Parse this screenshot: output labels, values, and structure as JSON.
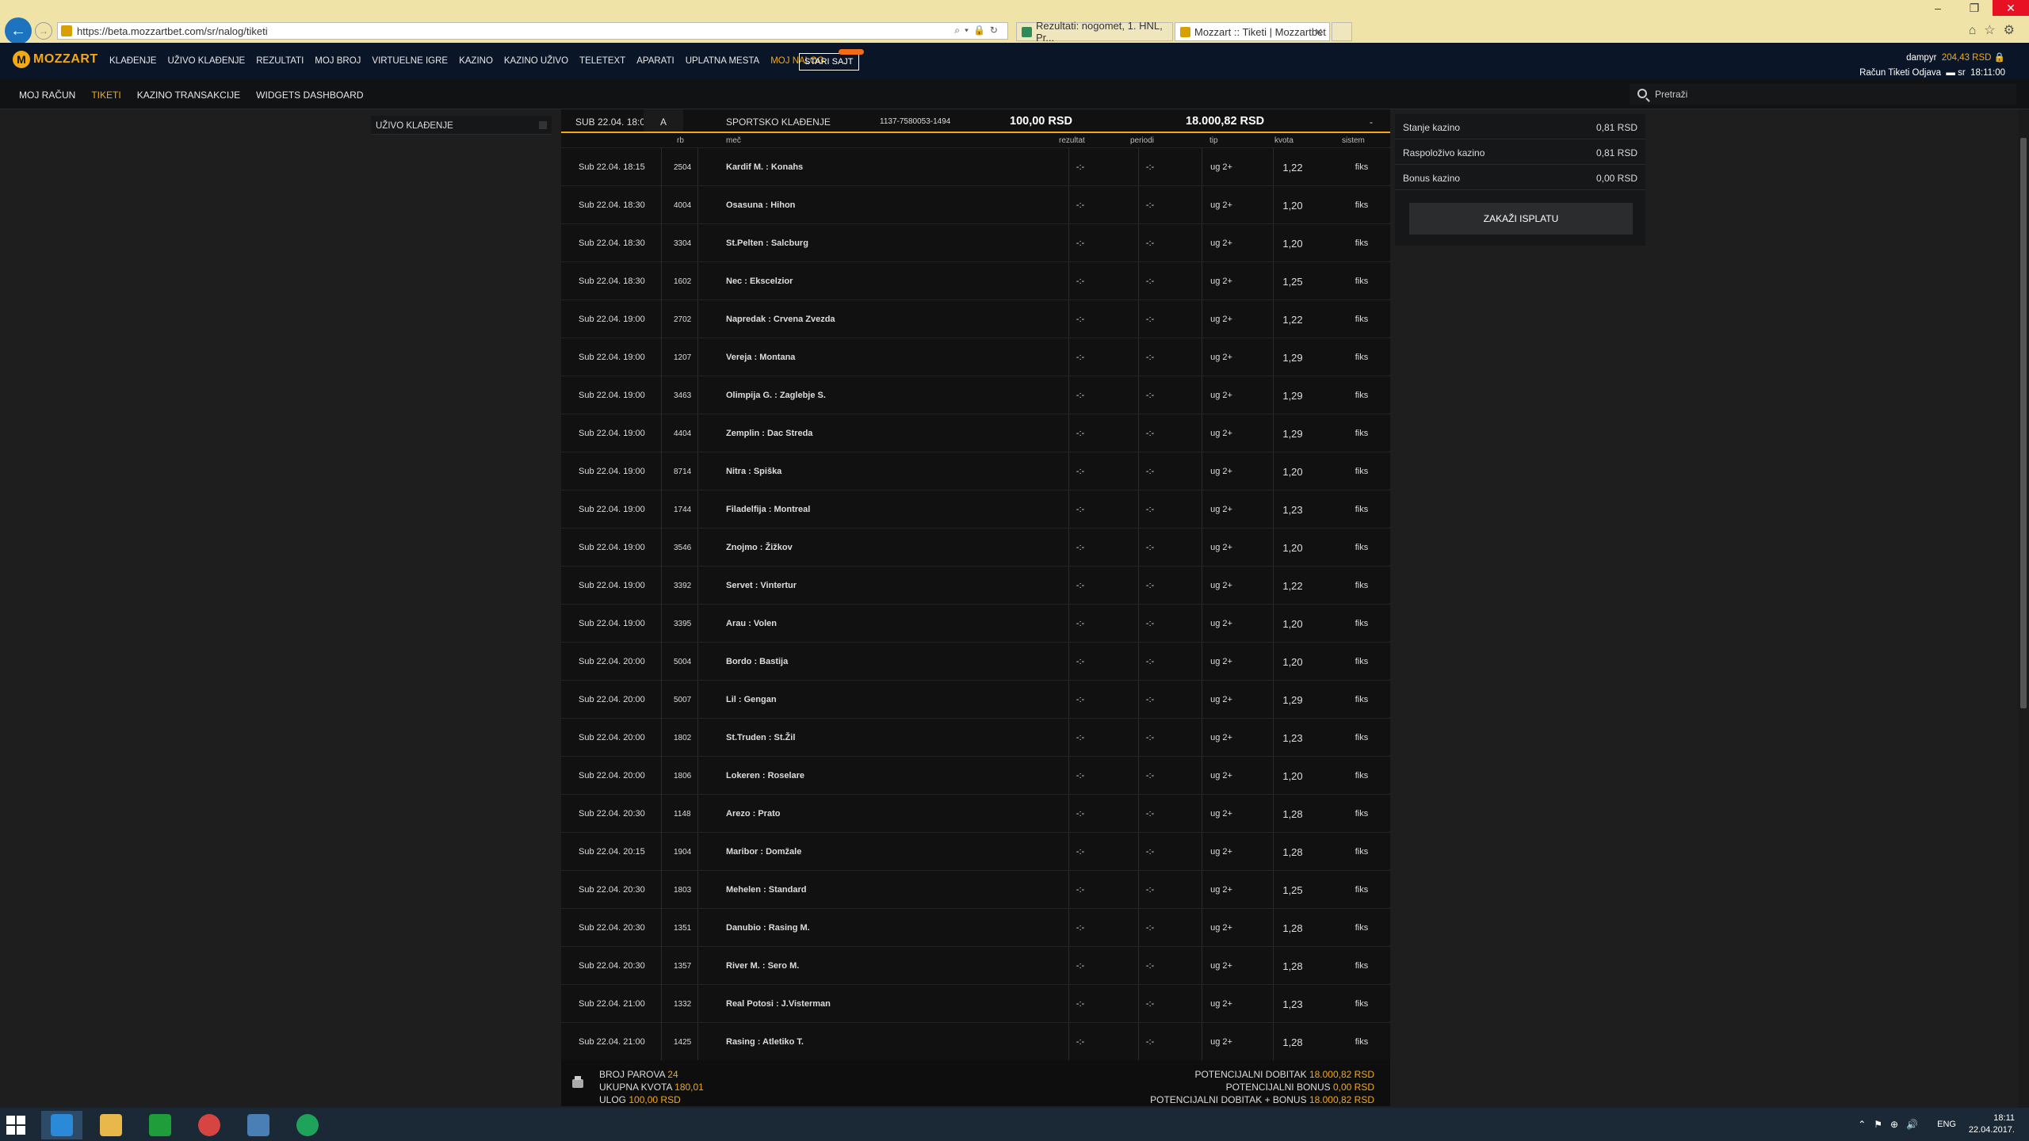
{
  "browser": {
    "url": "https://beta.mozzartbet.com/sr/nalog/tiketi",
    "tabs": [
      {
        "label": "Rezultati: nogomet, 1. HNL, Pr...",
        "color": "#2e8b57"
      },
      {
        "label": "Mozzart :: Tiketi | Mozzartbet",
        "color": "#d6a000"
      }
    ]
  },
  "header": {
    "logo_text": "MOZZART",
    "nav": [
      "KLAĐENJE",
      "UŽIVO KLAĐENJE",
      "REZULTATI",
      "MOJ BROJ",
      "VIRTUELNE IGRE",
      "KAZINO",
      "KAZINO UŽIVO",
      "TELETEXT",
      "APARATI",
      "UPLATNA MESTA",
      "MOJ NALOG"
    ],
    "active_nav": "MOJ NALOG",
    "stari_sajt": "STARI SAJT",
    "username": "dampyr",
    "balance": "204,43 RSD",
    "user_links": "Račun  Tiketi  Odjava",
    "lang": "sr",
    "time": "18:11:00"
  },
  "subnav": {
    "items": [
      "MOJ RAČUN",
      "TIKETI",
      "KAZINO TRANSAKCIJE",
      "WIDGETS DASHBOARD"
    ],
    "active": "TIKETI",
    "search_placeholder": "Pretraži"
  },
  "left_panel": {
    "label": "UŽIVO KLAĐENJE"
  },
  "ticket": {
    "date": "SUB 22.04. 18:08",
    "status": "A",
    "type": "SPORTSKO KLAĐENJE",
    "id": "1137-7580053-1494",
    "stake": "100,00 RSD",
    "win": "18.000,82 RSD",
    "dash": "-",
    "columns": {
      "rb": "rb",
      "mec": "meč",
      "rezultat": "rezultat",
      "periodi": "periodi",
      "tip": "tip",
      "kvota": "kvota",
      "sistem": "sistem"
    },
    "rows": [
      {
        "time": "Sub 22.04. 18:15",
        "rb": "2504",
        "match": "Kardif M. : Konahs",
        "rez": "-:-",
        "per": "-:-",
        "tip": "ug 2+",
        "kvota": "1,22",
        "sis": "fiks"
      },
      {
        "time": "Sub 22.04. 18:30",
        "rb": "4004",
        "match": "Osasuna : Hihon",
        "rez": "-:-",
        "per": "-:-",
        "tip": "ug 2+",
        "kvota": "1,20",
        "sis": "fiks"
      },
      {
        "time": "Sub 22.04. 18:30",
        "rb": "3304",
        "match": "St.Pelten : Salcburg",
        "rez": "-:-",
        "per": "-:-",
        "tip": "ug 2+",
        "kvota": "1,20",
        "sis": "fiks"
      },
      {
        "time": "Sub 22.04. 18:30",
        "rb": "1602",
        "match": "Nec : Ekscelzior",
        "rez": "-:-",
        "per": "-:-",
        "tip": "ug 2+",
        "kvota": "1,25",
        "sis": "fiks"
      },
      {
        "time": "Sub 22.04. 19:00",
        "rb": "2702",
        "match": "Napredak : Crvena Zvezda",
        "rez": "-:-",
        "per": "-:-",
        "tip": "ug 2+",
        "kvota": "1,22",
        "sis": "fiks"
      },
      {
        "time": "Sub 22.04. 19:00",
        "rb": "1207",
        "match": "Vereja : Montana",
        "rez": "-:-",
        "per": "-:-",
        "tip": "ug 2+",
        "kvota": "1,29",
        "sis": "fiks"
      },
      {
        "time": "Sub 22.04. 19:00",
        "rb": "3463",
        "match": "Olimpija G. : Zaglebje S.",
        "rez": "-:-",
        "per": "-:-",
        "tip": "ug 2+",
        "kvota": "1,29",
        "sis": "fiks"
      },
      {
        "time": "Sub 22.04. 19:00",
        "rb": "4404",
        "match": "Zemplin : Dac Streda",
        "rez": "-:-",
        "per": "-:-",
        "tip": "ug 2+",
        "kvota": "1,29",
        "sis": "fiks"
      },
      {
        "time": "Sub 22.04. 19:00",
        "rb": "8714",
        "match": "Nitra : Spiška",
        "rez": "-:-",
        "per": "-:-",
        "tip": "ug 2+",
        "kvota": "1,20",
        "sis": "fiks"
      },
      {
        "time": "Sub 22.04. 19:00",
        "rb": "1744",
        "match": "Filadelfija : Montreal",
        "rez": "-:-",
        "per": "-:-",
        "tip": "ug 2+",
        "kvota": "1,23",
        "sis": "fiks"
      },
      {
        "time": "Sub 22.04. 19:00",
        "rb": "3546",
        "match": "Znojmo : Žižkov",
        "rez": "-:-",
        "per": "-:-",
        "tip": "ug 2+",
        "kvota": "1,20",
        "sis": "fiks"
      },
      {
        "time": "Sub 22.04. 19:00",
        "rb": "3392",
        "match": "Servet : Vintertur",
        "rez": "-:-",
        "per": "-:-",
        "tip": "ug 2+",
        "kvota": "1,22",
        "sis": "fiks"
      },
      {
        "time": "Sub 22.04. 19:00",
        "rb": "3395",
        "match": "Arau : Volen",
        "rez": "-:-",
        "per": "-:-",
        "tip": "ug 2+",
        "kvota": "1,20",
        "sis": "fiks"
      },
      {
        "time": "Sub 22.04. 20:00",
        "rb": "5004",
        "match": "Bordo : Bastija",
        "rez": "-:-",
        "per": "-:-",
        "tip": "ug 2+",
        "kvota": "1,20",
        "sis": "fiks"
      },
      {
        "time": "Sub 22.04. 20:00",
        "rb": "5007",
        "match": "Lil : Gengan",
        "rez": "-:-",
        "per": "-:-",
        "tip": "ug 2+",
        "kvota": "1,29",
        "sis": "fiks"
      },
      {
        "time": "Sub 22.04. 20:00",
        "rb": "1802",
        "match": "St.Truden : St.Žil",
        "rez": "-:-",
        "per": "-:-",
        "tip": "ug 2+",
        "kvota": "1,23",
        "sis": "fiks"
      },
      {
        "time": "Sub 22.04. 20:00",
        "rb": "1806",
        "match": "Lokeren : Roselare",
        "rez": "-:-",
        "per": "-:-",
        "tip": "ug 2+",
        "kvota": "1,20",
        "sis": "fiks"
      },
      {
        "time": "Sub 22.04. 20:30",
        "rb": "1148",
        "match": "Arezo : Prato",
        "rez": "-:-",
        "per": "-:-",
        "tip": "ug 2+",
        "kvota": "1,28",
        "sis": "fiks"
      },
      {
        "time": "Sub 22.04. 20:15",
        "rb": "1904",
        "match": "Maribor : Domžale",
        "rez": "-:-",
        "per": "-:-",
        "tip": "ug 2+",
        "kvota": "1,28",
        "sis": "fiks"
      },
      {
        "time": "Sub 22.04. 20:30",
        "rb": "1803",
        "match": "Mehelen : Standard",
        "rez": "-:-",
        "per": "-:-",
        "tip": "ug 2+",
        "kvota": "1,25",
        "sis": "fiks"
      },
      {
        "time": "Sub 22.04. 20:30",
        "rb": "1351",
        "match": "Danubio : Rasing M.",
        "rez": "-:-",
        "per": "-:-",
        "tip": "ug 2+",
        "kvota": "1,28",
        "sis": "fiks"
      },
      {
        "time": "Sub 22.04. 20:30",
        "rb": "1357",
        "match": "River M. : Sero M.",
        "rez": "-:-",
        "per": "-:-",
        "tip": "ug 2+",
        "kvota": "1,28",
        "sis": "fiks"
      },
      {
        "time": "Sub 22.04. 21:00",
        "rb": "1332",
        "match": "Real Potosi : J.Visterman",
        "rez": "-:-",
        "per": "-:-",
        "tip": "ug 2+",
        "kvota": "1,23",
        "sis": "fiks"
      },
      {
        "time": "Sub 22.04. 21:00",
        "rb": "1425",
        "match": "Rasing : Atletiko T.",
        "rez": "-:-",
        "per": "-:-",
        "tip": "ug 2+",
        "kvota": "1,28",
        "sis": "fiks"
      }
    ],
    "footer": {
      "broj_parova_label": "BROJ PAROVA",
      "broj_parova": "24",
      "ukupna_kvota_label": "UKUPNA KVOTA",
      "ukupna_kvota": "180,01",
      "ulog_label": "ULOG",
      "ulog": "100,00 RSD",
      "pot_dobitak_label": "POTENCIJALNI DOBITAK",
      "pot_dobitak": "18.000,82 RSD",
      "pot_bonus_label": "POTENCIJALNI BONUS",
      "pot_bonus": "0,00 RSD",
      "pot_total_label": "POTENCIJALNI DOBITAK + BONUS",
      "pot_total": "18.000,82 RSD"
    }
  },
  "casino": {
    "rows": [
      {
        "label": "Stanje kazino",
        "value": "0,81 RSD"
      },
      {
        "label": "Raspoloživo kazino",
        "value": "0,81 RSD"
      },
      {
        "label": "Bonus kazino",
        "value": "0,00 RSD"
      }
    ],
    "payout_button": "ZAKAŽI ISPLATU"
  },
  "taskbar": {
    "lang": "ENG",
    "time": "18:11",
    "date": "22.04.2017."
  },
  "colors": {
    "accent": "#f3a916",
    "header_bg": "#0a1627"
  }
}
